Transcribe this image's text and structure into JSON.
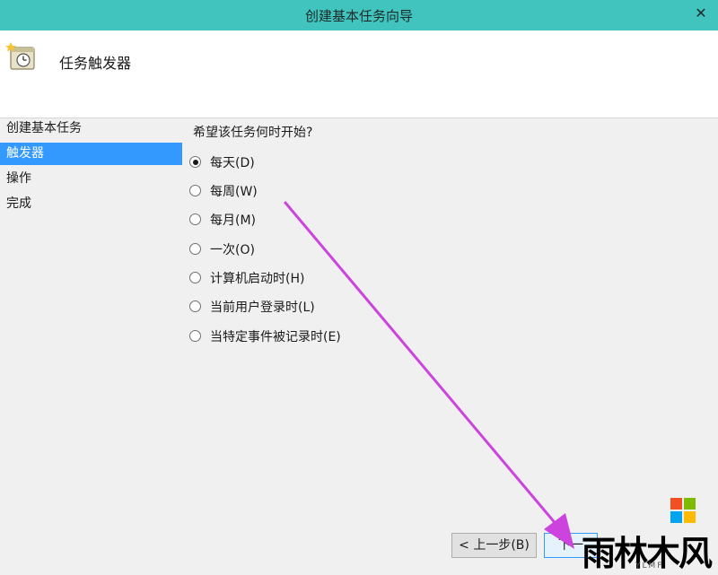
{
  "window": {
    "title": "创建基本任务向导",
    "close_glyph": "✕"
  },
  "header": {
    "title": "任务触发器",
    "icon": "scheduled-task-clock-icon"
  },
  "sidebar": {
    "items": [
      {
        "label": "创建基本任务",
        "active": false
      },
      {
        "label": "触发器",
        "active": true
      },
      {
        "label": "操作",
        "active": false
      },
      {
        "label": "完成",
        "active": false
      }
    ]
  },
  "main": {
    "question": "希望该任务何时开始?",
    "options": [
      {
        "label": "每天(D)",
        "checked": true
      },
      {
        "label": "每周(W)",
        "checked": false
      },
      {
        "label": "每月(M)",
        "checked": false
      },
      {
        "label": "一次(O)",
        "checked": false
      },
      {
        "label": "计算机启动时(H)",
        "checked": false
      },
      {
        "label": "当前用户登录时(L)",
        "checked": false
      },
      {
        "label": "当特定事件被记录时(E)",
        "checked": false
      }
    ]
  },
  "footer": {
    "back_label": "< 上一步(B)",
    "next_label": "下一"
  },
  "watermark": {
    "text": "雨林木风",
    "subtext": "YLMF",
    "logo_colors": [
      "#f25022",
      "#7fba00",
      "#00a4ef",
      "#ffb900"
    ]
  },
  "overlay": {
    "arrow_color": "#cc44dd"
  }
}
